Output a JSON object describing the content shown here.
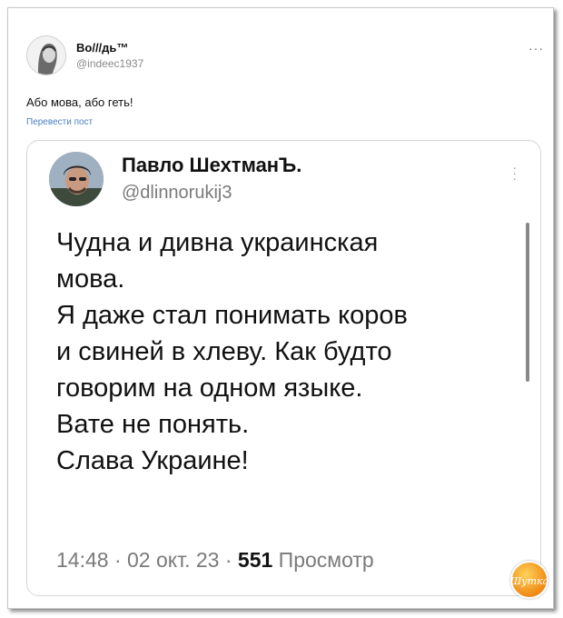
{
  "outer_post": {
    "author_name": "Во///дь™",
    "handle": "@indeec1937",
    "more_icon": "more-horizontal-icon",
    "text": "Або мова, або геть!",
    "translate_label": "Перевести пост"
  },
  "quoted_post": {
    "author_name": "Павло ШехтманЪ.",
    "handle": "@dlinnorukij3",
    "more_icon": "more-vertical-icon",
    "body": "Чудна и дивна украинская\nмова.\nЯ даже стал понимать коров\nи свиней в хлеву. Как будто\nговорим на одном языке.\nВате не понять.\nСлава Украине!",
    "time": "14:48",
    "date": "02 окт. 23",
    "separator": "·",
    "views_count": "551",
    "views_label": "Просмотр"
  },
  "watermark": {
    "icon": "site-logo-icon",
    "text": "Шутка",
    "color": "#f08a16"
  }
}
